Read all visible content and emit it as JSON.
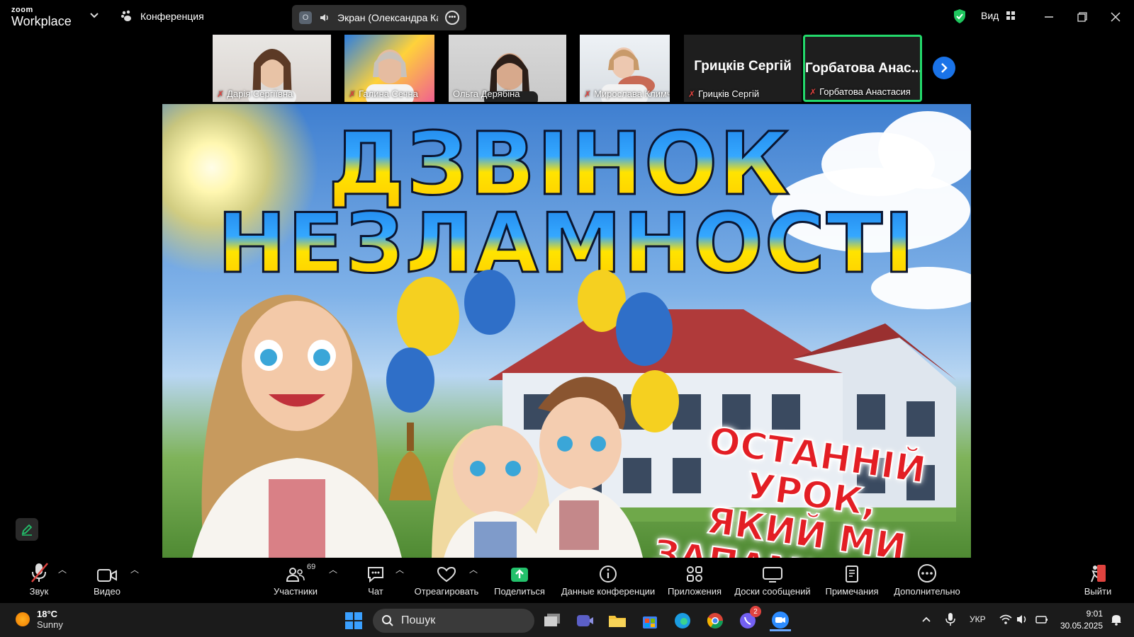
{
  "app": {
    "logo_small": "zoom",
    "logo_big": "Workplace",
    "conference_label": "Конференция",
    "share_badge": "O",
    "share_title": "Экран (Олександра Кардаш)",
    "view_label": "Вид"
  },
  "participants_strip": [
    {
      "name": "Дарія Сергіївна",
      "muted": true
    },
    {
      "name": "Галина Сечна",
      "muted": true
    },
    {
      "name": "Ольга Дерябіна",
      "muted": false
    },
    {
      "name": "Мирослава Климчук",
      "muted": true
    },
    {
      "name": "Грицків Сергій",
      "big_name": "Грицків Сергій",
      "muted": true
    },
    {
      "name": "Горбатова Анастасия",
      "big_name": "Горбатова Анас...",
      "muted": true,
      "active_speaker": true
    }
  ],
  "shared_content": {
    "title_line1": "ДЗВІНОК",
    "title_line2": "НЕЗЛАМНОСТІ",
    "subtitle_line1": "ОСТАННІЙ УРОК,",
    "subtitle_line2": "ЯКИЙ МИ",
    "subtitle_line3": "ЗАПАМ'ЯТАЄМО!"
  },
  "toolbar": {
    "audio": "Звук",
    "video": "Видео",
    "participants": "Участники",
    "participants_count": "69",
    "chat": "Чат",
    "react": "Отреагировать",
    "share": "Поделиться",
    "info": "Данные конференции",
    "apps": "Приложения",
    "whiteboards": "Доски сообщений",
    "notes": "Примечания",
    "more": "Дополнительно",
    "leave": "Выйти"
  },
  "taskbar": {
    "temp": "18°C",
    "weather": "Sunny",
    "search_placeholder": "Пошук",
    "lang": "УКР",
    "time": "9:01",
    "date": "30.05.2025",
    "notification_badge": "2"
  },
  "colors": {
    "active_speaker": "#23d96b",
    "share_green": "#23c16b",
    "mic_off_red": "#e0433f",
    "accent_blue": "#1a73e8"
  }
}
